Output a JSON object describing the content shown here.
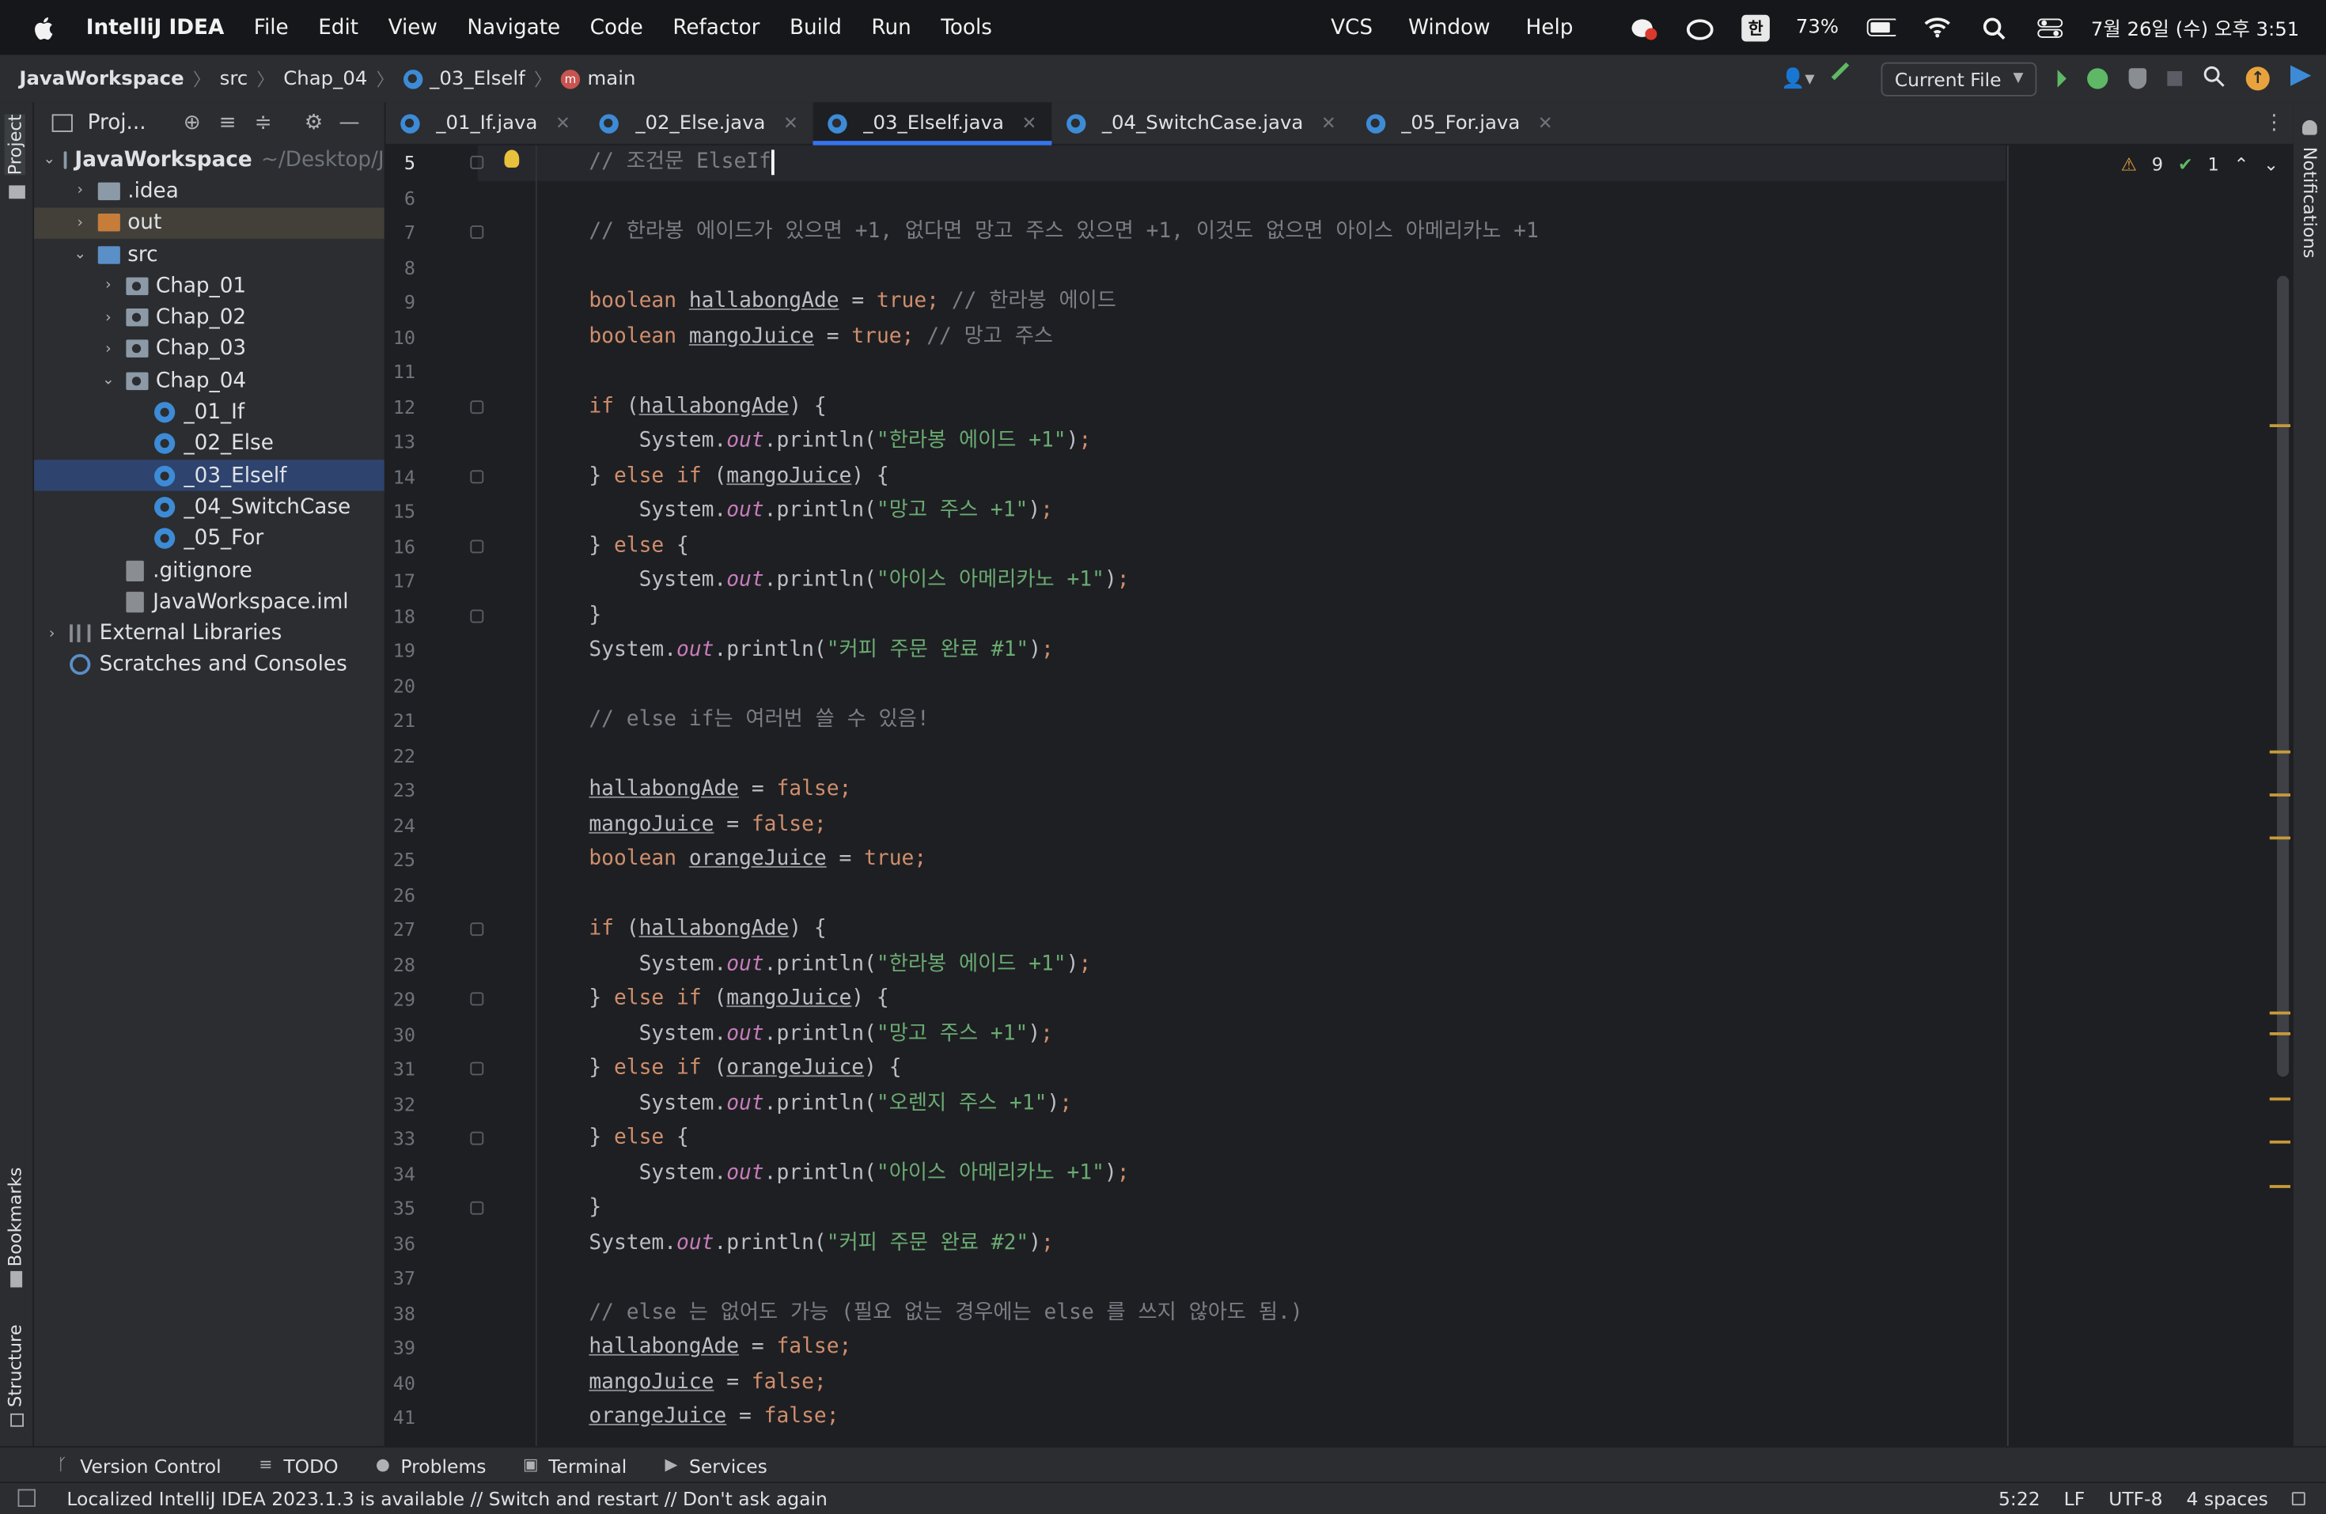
{
  "menubar": {
    "app_name": "IntelliJ IDEA",
    "items": [
      "File",
      "Edit",
      "View",
      "Navigate",
      "Code",
      "Refactor",
      "Build",
      "Run",
      "Tools"
    ],
    "right_items": [
      "VCS",
      "Window",
      "Help"
    ],
    "input_method": "한",
    "battery": "73%",
    "datetime": "7월 26일 (수) 오후 3:51"
  },
  "breadcrumb": {
    "project": "JavaWorkspace",
    "src": "src",
    "package": "Chap_04",
    "class": "_03_Elself",
    "method": "main"
  },
  "toolbar": {
    "run_config": "Current File"
  },
  "left_strip": {
    "project": "Project",
    "bookmarks": "Bookmarks",
    "structure": "Structure"
  },
  "right_strip": {
    "notifications": "Notifications"
  },
  "project_panel": {
    "title": "Proj...",
    "tree": [
      {
        "label": "JavaWorkspace",
        "extra": "~/Desktop/J",
        "depth": 0,
        "type": "project",
        "arrow": "⌄"
      },
      {
        "label": ".idea",
        "depth": 1,
        "type": "folder",
        "arrow": "›"
      },
      {
        "label": "out",
        "depth": 1,
        "type": "folder-orange",
        "arrow": "›"
      },
      {
        "label": "src",
        "depth": 1,
        "type": "folder-blue",
        "arrow": "⌄"
      },
      {
        "label": "Chap_01",
        "depth": 2,
        "type": "package",
        "arrow": "›"
      },
      {
        "label": "Chap_02",
        "depth": 2,
        "type": "package",
        "arrow": "›"
      },
      {
        "label": "Chap_03",
        "depth": 2,
        "type": "package",
        "arrow": "›"
      },
      {
        "label": "Chap_04",
        "depth": 2,
        "type": "package",
        "arrow": "⌄"
      },
      {
        "label": "_01_If",
        "depth": 3,
        "type": "class",
        "arrow": ""
      },
      {
        "label": "_02_Else",
        "depth": 3,
        "type": "class",
        "arrow": ""
      },
      {
        "label": "_03_Elself",
        "depth": 3,
        "type": "class",
        "arrow": "",
        "selected": true
      },
      {
        "label": "_04_SwitchCase",
        "depth": 3,
        "type": "class",
        "arrow": ""
      },
      {
        "label": "_05_For",
        "depth": 3,
        "type": "class",
        "arrow": ""
      },
      {
        "label": ".gitignore",
        "depth": 2,
        "type": "git",
        "arrow": ""
      },
      {
        "label": "JavaWorkspace.iml",
        "depth": 2,
        "type": "git",
        "arrow": ""
      },
      {
        "label": "External Libraries",
        "depth": 0,
        "type": "lib",
        "arrow": "›"
      },
      {
        "label": "Scratches and Consoles",
        "depth": 0,
        "type": "scratch",
        "arrow": ""
      }
    ]
  },
  "tabs": [
    {
      "label": "_01_If.java",
      "active": false
    },
    {
      "label": "_02_Else.java",
      "active": false
    },
    {
      "label": "_03_Elself.java",
      "active": true
    },
    {
      "label": "_04_SwitchCase.java",
      "active": false
    },
    {
      "label": "_05_For.java",
      "active": false
    }
  ],
  "editor": {
    "warnings": "9",
    "checks": "1",
    "first_line": 5,
    "lines": [
      "    // 조건문 ElseIf",
      "",
      "    // 한라봉 에이드가 있으면 +1, 없다면 망고 주스 있으면 +1, 이것도 없으면 아이스 아메리카노 +1",
      "",
      "    boolean hallabongAde = true; // 한라봉 에이드",
      "    boolean mangoJuice = true; // 망고 주스",
      "",
      "    if (hallabongAde) {",
      "        System.out.println(\"한라봉 에이드 +1\");",
      "    } else if (mangoJuice) {",
      "        System.out.println(\"망고 주스 +1\");",
      "    } else {",
      "        System.out.println(\"아이스 아메리카노 +1\");",
      "    }",
      "    System.out.println(\"커피 주문 완료 #1\");",
      "",
      "    // else if는 여러번 쓸 수 있음!",
      "",
      "    hallabongAde = false;",
      "    mangoJuice = false;",
      "    boolean orangeJuice = true;",
      "",
      "    if (hallabongAde) {",
      "        System.out.println(\"한라봉 에이드 +1\");",
      "    } else if (mangoJuice) {",
      "        System.out.println(\"망고 주스 +1\");",
      "    } else if (orangeJuice) {",
      "        System.out.println(\"오렌지 주스 +1\");",
      "    } else {",
      "        System.out.println(\"아이스 아메리카노 +1\");",
      "    }",
      "    System.out.println(\"커피 주문 완료 #2\");",
      "",
      "    // else 는 없어도 가능 (필요 없는 경우에는 else 를 쓰지 않아도 됨.)",
      "    hallabongAde = false;",
      "    mangoJuice = false;",
      "    orangeJuice = false;"
    ]
  },
  "bottom_tools": [
    "Version Control",
    "TODO",
    "Problems",
    "Terminal",
    "Services"
  ],
  "status": {
    "message": "Localized IntelliJ IDEA 2023.1.3 is available // Switch and restart // Don't ask again",
    "position": "5:22",
    "line_sep": "LF",
    "encoding": "UTF-8",
    "indent": "4 spaces"
  }
}
